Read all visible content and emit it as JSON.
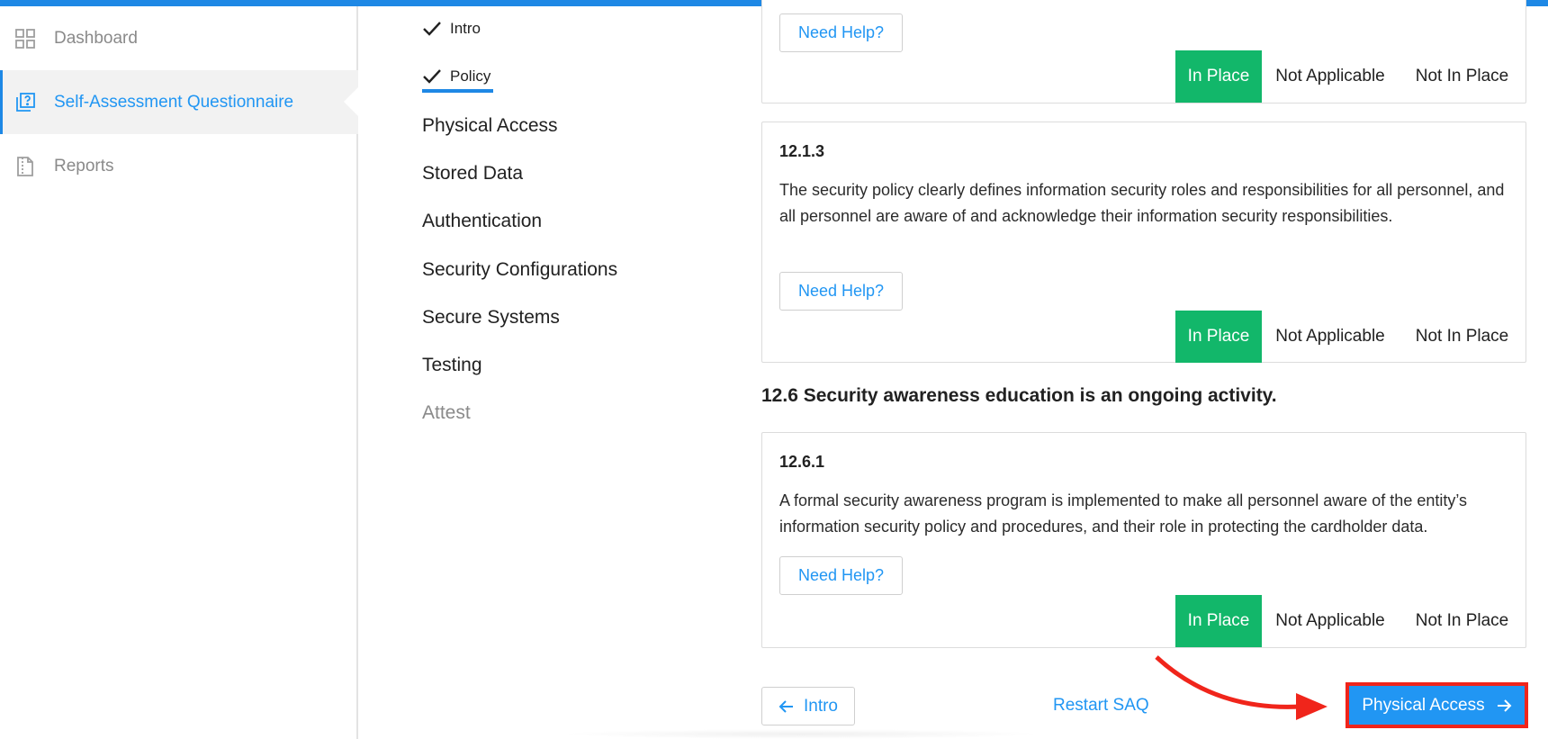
{
  "colors": {
    "accent": "#2196f3",
    "in_place": "#12b76a",
    "highlight": "#f0251b"
  },
  "sidebar": {
    "items": [
      {
        "label": "Dashboard",
        "icon": "grid-icon",
        "active": false
      },
      {
        "label": "Self-Assessment Questionnaire",
        "icon": "questionnaire-icon",
        "active": true
      },
      {
        "label": "Reports",
        "icon": "report-icon",
        "active": false
      }
    ]
  },
  "steps": {
    "completed": [
      "Intro",
      "Policy"
    ],
    "current": "Policy",
    "remaining": [
      "Physical Access",
      "Stored Data",
      "Authentication",
      "Security Configurations",
      "Secure Systems",
      "Testing"
    ],
    "final": "Attest"
  },
  "questions": [
    {
      "id": "",
      "text": "",
      "help_label": "Need Help?",
      "answers": {
        "in_place": "In Place",
        "not_applicable": "Not Applicable",
        "not_in_place": "Not In Place"
      },
      "selected": "In Place"
    },
    {
      "id": "12.1.3",
      "text": "The security policy clearly defines information security roles and responsibilities for all personnel, and all personnel are aware of and acknowledge their information security responsibilities.",
      "help_label": "Need Help?",
      "answers": {
        "in_place": "In Place",
        "not_applicable": "Not Applicable",
        "not_in_place": "Not In Place"
      },
      "selected": "In Place"
    },
    {
      "id": "12.6.1",
      "text": "A formal security awareness program is implemented to make all personnel aware of the entity’s information security policy and procedures, and their role in protecting the cardholder data.",
      "help_label": "Need Help?",
      "answers": {
        "in_place": "In Place",
        "not_applicable": "Not Applicable",
        "not_in_place": "Not In Place"
      },
      "selected": "In Place"
    }
  ],
  "section_heading": "12.6 Security awareness education is an ongoing activity.",
  "footer": {
    "prev_label": "Intro",
    "restart_label": "Restart SAQ",
    "next_label": "Physical Access"
  }
}
